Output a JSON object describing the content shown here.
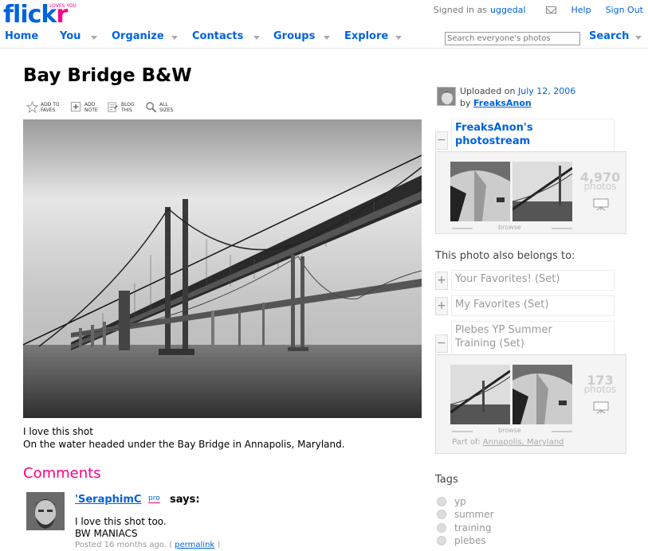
{
  "header": {
    "logo_text_f": "flick",
    "logo_text_r": "r",
    "logo_tagline": "LOVES YOU",
    "signed_in_prefix": "Signed in as",
    "username": "uggedal",
    "help": "Help",
    "sign_out": "Sign Out"
  },
  "nav": {
    "home": "Home",
    "you": "You",
    "organize": "Organize",
    "contacts": "Contacts",
    "groups": "Groups",
    "explore": "Explore",
    "search_placeholder": "Search everyone's photos",
    "search_button": "Search"
  },
  "photo": {
    "title": "Bay Bridge B&W",
    "caption_line1": "I love this shot",
    "caption_line2": "On the water headed under the Bay Bridge in Annapolis, Maryland."
  },
  "toolbar": {
    "add_to_faves_1": "ADD TO",
    "add_to_faves_2": "FAVES",
    "add_note_1": "ADD",
    "add_note_2": "NOTE",
    "blog_this_1": "BLOG",
    "blog_this_2": "THIS",
    "all_sizes_1": "ALL",
    "all_sizes_2": "SIZES"
  },
  "comments": {
    "heading": "Comments",
    "items": [
      {
        "author": "'SeraphimC",
        "pro": "pro",
        "says": "says:",
        "line1": "I love this shot too.",
        "line2": "BW MANIACS",
        "posted": "Posted 16 months ago. (",
        "permalink": "permalink",
        "posted_end": ")"
      }
    ]
  },
  "sidebar": {
    "uploaded_prefix": "Uploaded on",
    "uploaded_date": "July 12, 2006",
    "by": "by",
    "owner": "FreaksAnon",
    "photostream_title_1": "FreaksAnon's",
    "photostream_title_2": "photostream",
    "photostream_count": "4,970",
    "photos_label": "photos",
    "browse": "browse",
    "belongs_to": "This photo also belongs to:",
    "sets": [
      {
        "label": "Your Favorites! (Set)",
        "toggle": "+"
      },
      {
        "label": "My Favorites (Set)",
        "toggle": "+"
      },
      {
        "label_1": "Plebes YP Summer",
        "label_2": "Training (Set)",
        "toggle": "−"
      }
    ],
    "plebes_count": "173",
    "part_of_prefix": "Part of:",
    "part_of_link": "Annapolis, Maryland",
    "tags_heading": "Tags",
    "tags": [
      "yp",
      "summer",
      "training",
      "plebes"
    ]
  }
}
